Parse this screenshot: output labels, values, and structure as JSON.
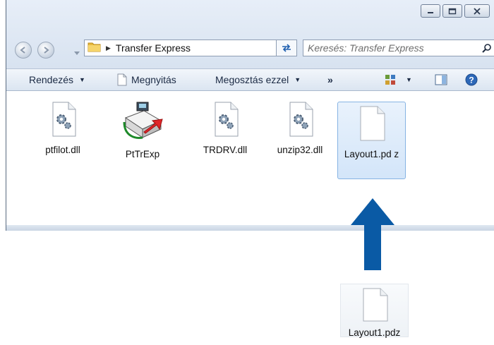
{
  "window": {
    "controls": {
      "minimize": "minimize-icon",
      "maximize": "maximize-icon",
      "close": "close-icon"
    }
  },
  "address_bar": {
    "path": "Transfer Express"
  },
  "search": {
    "placeholder": "Keresés: Transfer Express"
  },
  "toolbar": {
    "organize_label": "Rendezés",
    "open_label": "Megnyitás",
    "share_label": "Megosztás ezzel",
    "more_label": "»"
  },
  "files": [
    {
      "name": "ptfilot.dll",
      "icon": "dll-gear-icon"
    },
    {
      "name": "PtTrExp",
      "icon": "printer-app-icon"
    },
    {
      "name": "TRDRV.dll",
      "icon": "dll-gear-icon"
    },
    {
      "name": "unzip32.dll",
      "icon": "dll-gear-icon"
    },
    {
      "name": "Layout1.pd z",
      "icon": "blank-document-icon",
      "selected": true
    }
  ],
  "dragged_file": {
    "name": "Layout1.pdz",
    "icon": "blank-document-icon"
  },
  "colors": {
    "arrow": "#0a5aa5",
    "selection": "#d3e5f9",
    "toolbar": "#dbe5f1"
  }
}
